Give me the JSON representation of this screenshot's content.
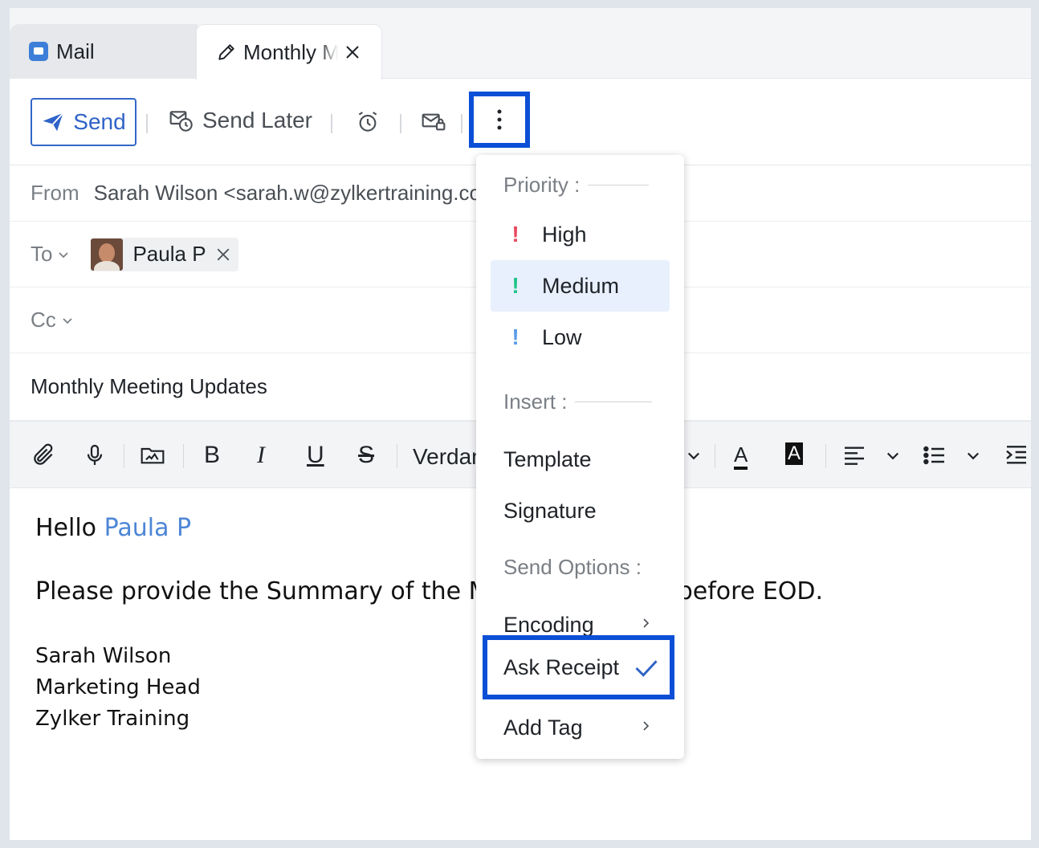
{
  "tabs": [
    {
      "label": "Mail"
    },
    {
      "label": "Monthly Meeting Updates"
    }
  ],
  "toolbar": {
    "send_label": "Send",
    "send_later_label": "Send Later"
  },
  "header": {
    "from_label": "From",
    "from_value": "Sarah Wilson <sarah.w@zylkertraining.com>",
    "to_label": "To",
    "cc_label": "Cc",
    "recipients": [
      {
        "name": "Paula P"
      }
    ],
    "subject": "Monthly Meeting Updates"
  },
  "format_bar": {
    "font_name": "Verdana",
    "bold": "B",
    "italic": "I",
    "underline": "U",
    "strike": "S",
    "font_color": "A",
    "bg_color": "A"
  },
  "body": {
    "greeting": "Hello",
    "greeting_name": "Paula P",
    "paragraph": "Please provide the Summary of the Monthly Meeting before EOD.",
    "signature": [
      "Sarah Wilson",
      "Marketing Head",
      "Zylker Training"
    ]
  },
  "menu": {
    "priority_label": "Priority :",
    "priority": [
      {
        "label": "High",
        "color": "#e84a5f"
      },
      {
        "label": "Medium",
        "color": "#1fc48a",
        "selected": true
      },
      {
        "label": "Low",
        "color": "#5a9de8"
      }
    ],
    "insert_label": "Insert :",
    "insert": [
      {
        "label": "Template"
      },
      {
        "label": "Signature"
      }
    ],
    "send_options_label": "Send Options :",
    "send_options": [
      {
        "label": "Encoding",
        "has_submenu": true
      },
      {
        "label": "Ask Receipt",
        "checked": true
      },
      {
        "label": "Add Tag",
        "has_submenu": true
      }
    ]
  },
  "colors": {
    "accent": "#2f63c7",
    "highlight_border": "#0a4fd6",
    "selected_bg": "#e8f0fd"
  }
}
